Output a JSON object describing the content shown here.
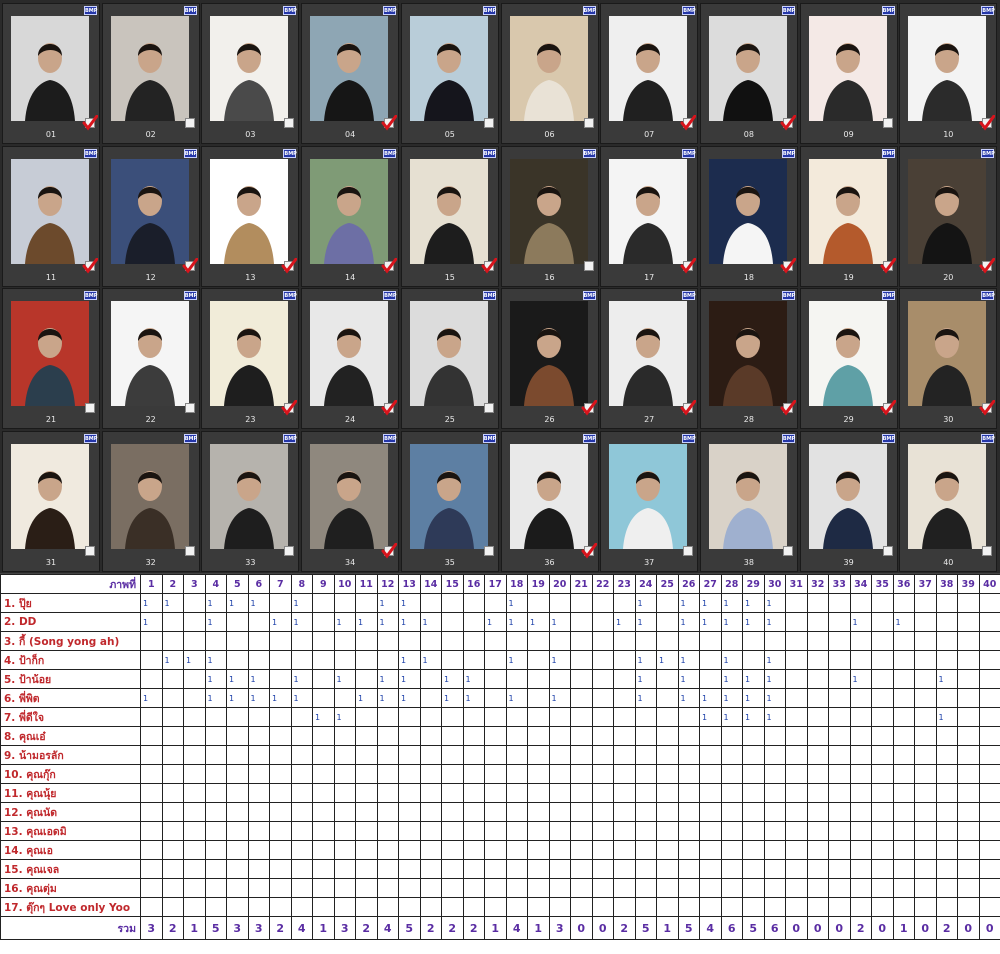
{
  "gallery": {
    "badge_label": "BMP",
    "tiles": [
      {
        "caption": "01",
        "checked": true,
        "bg": "#d8d8d8",
        "tone": "#1c1c1c"
      },
      {
        "caption": "02",
        "checked": false,
        "bg": "#c9c4bd",
        "tone": "#232323"
      },
      {
        "caption": "03",
        "checked": false,
        "bg": "#f2f0ec",
        "tone": "#4a4a4a"
      },
      {
        "caption": "04",
        "checked": true,
        "bg": "#8ea6b4",
        "tone": "#161616"
      },
      {
        "caption": "05",
        "checked": false,
        "bg": "#b9cdd9",
        "tone": "#15151c"
      },
      {
        "caption": "06",
        "checked": false,
        "bg": "#d9c8ad",
        "tone": "#e9e2d6"
      },
      {
        "caption": "07",
        "checked": true,
        "bg": "#efefef",
        "tone": "#202020"
      },
      {
        "caption": "08",
        "checked": true,
        "bg": "#dcdcdc",
        "tone": "#111111"
      },
      {
        "caption": "09",
        "checked": false,
        "bg": "#f4e9e6",
        "tone": "#2a2a2a"
      },
      {
        "caption": "10",
        "checked": true,
        "bg": "#f3f3f3",
        "tone": "#2b2b2b"
      },
      {
        "caption": "11",
        "checked": true,
        "bg": "#c7ccd6",
        "tone": "#6c4a2c"
      },
      {
        "caption": "12",
        "checked": true,
        "bg": "#3b4f7a",
        "tone": "#1a1e2a"
      },
      {
        "caption": "13",
        "checked": true,
        "bg": "#ffffff",
        "tone": "#b28d5e"
      },
      {
        "caption": "14",
        "checked": true,
        "bg": "#7f9b76",
        "tone": "#6d6fa5"
      },
      {
        "caption": "15",
        "checked": true,
        "bg": "#e6e0d2",
        "tone": "#1d1d1d"
      },
      {
        "caption": "16",
        "checked": false,
        "bg": "#3a3428",
        "tone": "#8c7a5c"
      },
      {
        "caption": "17",
        "checked": true,
        "bg": "#f4f4f4",
        "tone": "#2a2a2a"
      },
      {
        "caption": "18",
        "checked": true,
        "bg": "#1c2c4e",
        "tone": "#f5f5f5"
      },
      {
        "caption": "19",
        "checked": true,
        "bg": "#f3eadb",
        "tone": "#b45a2c"
      },
      {
        "caption": "20",
        "checked": true,
        "bg": "#4a4036",
        "tone": "#141414"
      },
      {
        "caption": "21",
        "checked": false,
        "bg": "#b8362a",
        "tone": "#2b3e4d"
      },
      {
        "caption": "22",
        "checked": false,
        "bg": "#f5f5f5",
        "tone": "#3c3c3c"
      },
      {
        "caption": "23",
        "checked": true,
        "bg": "#f1ecd9",
        "tone": "#1e1e1e"
      },
      {
        "caption": "24",
        "checked": true,
        "bg": "#e8e8e8",
        "tone": "#222222"
      },
      {
        "caption": "25",
        "checked": false,
        "bg": "#dcdcdc",
        "tone": "#333333"
      },
      {
        "caption": "26",
        "checked": true,
        "bg": "#1a1a1a",
        "tone": "#7b4a2e"
      },
      {
        "caption": "27",
        "checked": true,
        "bg": "#ededed",
        "tone": "#2a2a2a"
      },
      {
        "caption": "28",
        "checked": true,
        "bg": "#2c1c14",
        "tone": "#5a3a28"
      },
      {
        "caption": "29",
        "checked": true,
        "bg": "#f5f5f2",
        "tone": "#5fa0a6"
      },
      {
        "caption": "30",
        "checked": true,
        "bg": "#a88d6a",
        "tone": "#232323"
      },
      {
        "caption": "31",
        "checked": false,
        "bg": "#f0eadf",
        "tone": "#2a1e16"
      },
      {
        "caption": "32",
        "checked": false,
        "bg": "#7a6e62",
        "tone": "#3a2f26"
      },
      {
        "caption": "33",
        "checked": false,
        "bg": "#b6b3ad",
        "tone": "#1e1e1e"
      },
      {
        "caption": "34",
        "checked": true,
        "bg": "#8f887e",
        "tone": "#1f1f1f"
      },
      {
        "caption": "35",
        "checked": false,
        "bg": "#5d7fa3",
        "tone": "#2e3a58"
      },
      {
        "caption": "36",
        "checked": true,
        "bg": "#e9e9e9",
        "tone": "#1b1b1b"
      },
      {
        "caption": "37",
        "checked": false,
        "bg": "#8fc7d8",
        "tone": "#efefef"
      },
      {
        "caption": "38",
        "checked": false,
        "bg": "#d9d2c8",
        "tone": "#9fb0cf"
      },
      {
        "caption": "39",
        "checked": false,
        "bg": "#e2e2e2",
        "tone": "#1e2a44"
      },
      {
        "caption": "40",
        "checked": false,
        "bg": "#e8e2d6",
        "tone": "#202020"
      }
    ]
  },
  "vote_table": {
    "header_label": "ภาพที่",
    "column_numbers": [
      "1",
      "2",
      "3",
      "4",
      "5",
      "6",
      "7",
      "8",
      "9",
      "10",
      "11",
      "12",
      "13",
      "14",
      "15",
      "16",
      "17",
      "18",
      "19",
      "20",
      "21",
      "22",
      "23",
      "24",
      "25",
      "26",
      "27",
      "28",
      "29",
      "30",
      "31",
      "32",
      "33",
      "34",
      "35",
      "36",
      "37",
      "38",
      "39",
      "40"
    ],
    "mark_symbol": "1",
    "voters": [
      {
        "name": "1.  ปุ๊ย",
        "votes": [
          1,
          2,
          4,
          5,
          6,
          8,
          12,
          13,
          18,
          24,
          26,
          27,
          28,
          29,
          30
        ]
      },
      {
        "name": "2.  DD",
        "votes": [
          1,
          4,
          7,
          8,
          10,
          11,
          12,
          13,
          14,
          17,
          18,
          19,
          20,
          23,
          24,
          26,
          27,
          28,
          29,
          30,
          34,
          36
        ]
      },
      {
        "name": "3.  กี้ (Song yong ah)",
        "votes": []
      },
      {
        "name": "4.  ป้าก็ก",
        "votes": [
          2,
          3,
          4,
          13,
          14,
          18,
          20,
          24,
          25,
          26,
          28,
          30
        ]
      },
      {
        "name": "5.  ป้าน้อย",
        "votes": [
          4,
          5,
          6,
          8,
          10,
          12,
          13,
          15,
          16,
          24,
          26,
          28,
          29,
          30,
          34,
          38
        ]
      },
      {
        "name": "6.  พี่พิต",
        "votes": [
          1,
          4,
          5,
          6,
          7,
          8,
          11,
          12,
          13,
          15,
          16,
          18,
          20,
          24,
          26,
          27,
          28,
          29,
          30
        ]
      },
      {
        "name": "7.  พี่ดีใจ",
        "votes": [
          9,
          10,
          27,
          28,
          29,
          30,
          38
        ]
      },
      {
        "name": "8.  คุณเอ๋",
        "votes": []
      },
      {
        "name": "9.  น้ามอรลัก",
        "votes": []
      },
      {
        "name": "10.  คุณกุ๊ก",
        "votes": []
      },
      {
        "name": "11.  คุณนุ้ย",
        "votes": []
      },
      {
        "name": "12.  คุณนัด",
        "votes": []
      },
      {
        "name": "13.  คุณเอดมิ",
        "votes": []
      },
      {
        "name": "14.  คุณเอ",
        "votes": []
      },
      {
        "name": "15.  คุณเจล",
        "votes": []
      },
      {
        "name": "16.  คุณตุ่ม",
        "votes": []
      },
      {
        "name": "17.  ตุ๊กๆ Love only Yoo",
        "votes": []
      }
    ],
    "total_label": "รวม",
    "totals": [
      "3",
      "2",
      "1",
      "5",
      "3",
      "3",
      "2",
      "4",
      "1",
      "3",
      "2",
      "4",
      "5",
      "2",
      "2",
      "2",
      "1",
      "4",
      "1",
      "3",
      "0",
      "0",
      "2",
      "5",
      "1",
      "5",
      "4",
      "6",
      "5",
      "6",
      "0",
      "0",
      "0",
      "2",
      "0",
      "1",
      "0",
      "2",
      "0",
      "0"
    ]
  },
  "colors": {
    "voter_name": "#c0282c",
    "header": "#5a2da3",
    "mark": "#1a3fa8",
    "check": "#d8141c"
  }
}
